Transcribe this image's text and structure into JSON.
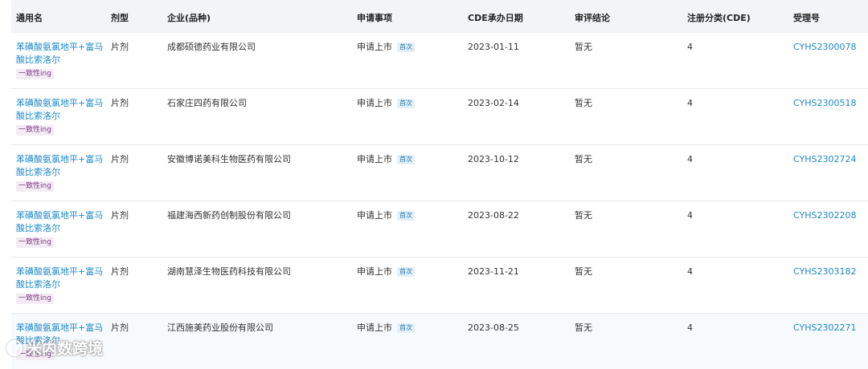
{
  "table": {
    "headers": {
      "generic_name": "通用名",
      "dosage_form": "剂型",
      "company": "企业(品种)",
      "application_item": "申请事项",
      "cde_date": "CDE承办日期",
      "review_conclusion": "审评结论",
      "registration_class": "注册分类(CDE)",
      "acceptance_no": "受理号"
    },
    "rows": [
      {
        "drug": "苯磺酸氨氯地平+富马酸比索洛尔",
        "tag": "一致性ing",
        "form": "片剂",
        "company": "成都硕德药业有限公司",
        "application": "申请上市",
        "badge": "首次",
        "date": "2023-01-11",
        "conclusion": "暂无",
        "class": "4",
        "number": "CYHS2300078"
      },
      {
        "drug": "苯磺酸氨氯地平+富马酸比索洛尔",
        "tag": "一致性ing",
        "form": "片剂",
        "company": "石家庄四药有限公司",
        "application": "申请上市",
        "badge": "首次",
        "date": "2023-02-14",
        "conclusion": "暂无",
        "class": "4",
        "number": "CYHS2300518"
      },
      {
        "drug": "苯磺酸氨氯地平+富马酸比索洛尔",
        "tag": "一致性ing",
        "form": "片剂",
        "company": "安徽博诺美科生物医药有限公司",
        "application": "申请上市",
        "badge": "首次",
        "date": "2023-10-12",
        "conclusion": "暂无",
        "class": "4",
        "number": "CYHS2302724"
      },
      {
        "drug": "苯磺酸氨氯地平+富马酸比索洛尔",
        "tag": "一致性ing",
        "form": "片剂",
        "company": "福建海西新药创制股份有限公司",
        "application": "申请上市",
        "badge": "首次",
        "date": "2023-08-22",
        "conclusion": "暂无",
        "class": "4",
        "number": "CYHS2302208"
      },
      {
        "drug": "苯磺酸氨氯地平+富马酸比索洛尔",
        "tag": "一致性ing",
        "form": "片剂",
        "company": "湖南慧泽生物医药科技有限公司",
        "application": "申请上市",
        "badge": "首次",
        "date": "2023-11-21",
        "conclusion": "暂无",
        "class": "4",
        "number": "CYHS2303182"
      },
      {
        "drug": "苯磺酸氨氯地平+富马酸比索洛尔",
        "tag": "一致性ing",
        "form": "片剂",
        "company": "江西施美药业股份有限公司",
        "application": "申请上市",
        "badge": "首次",
        "date": "2023-08-25",
        "conclusion": "暂无",
        "class": "4",
        "number": "CYHS2302271"
      }
    ]
  },
  "watermark": {
    "text": "米内数跨境"
  }
}
